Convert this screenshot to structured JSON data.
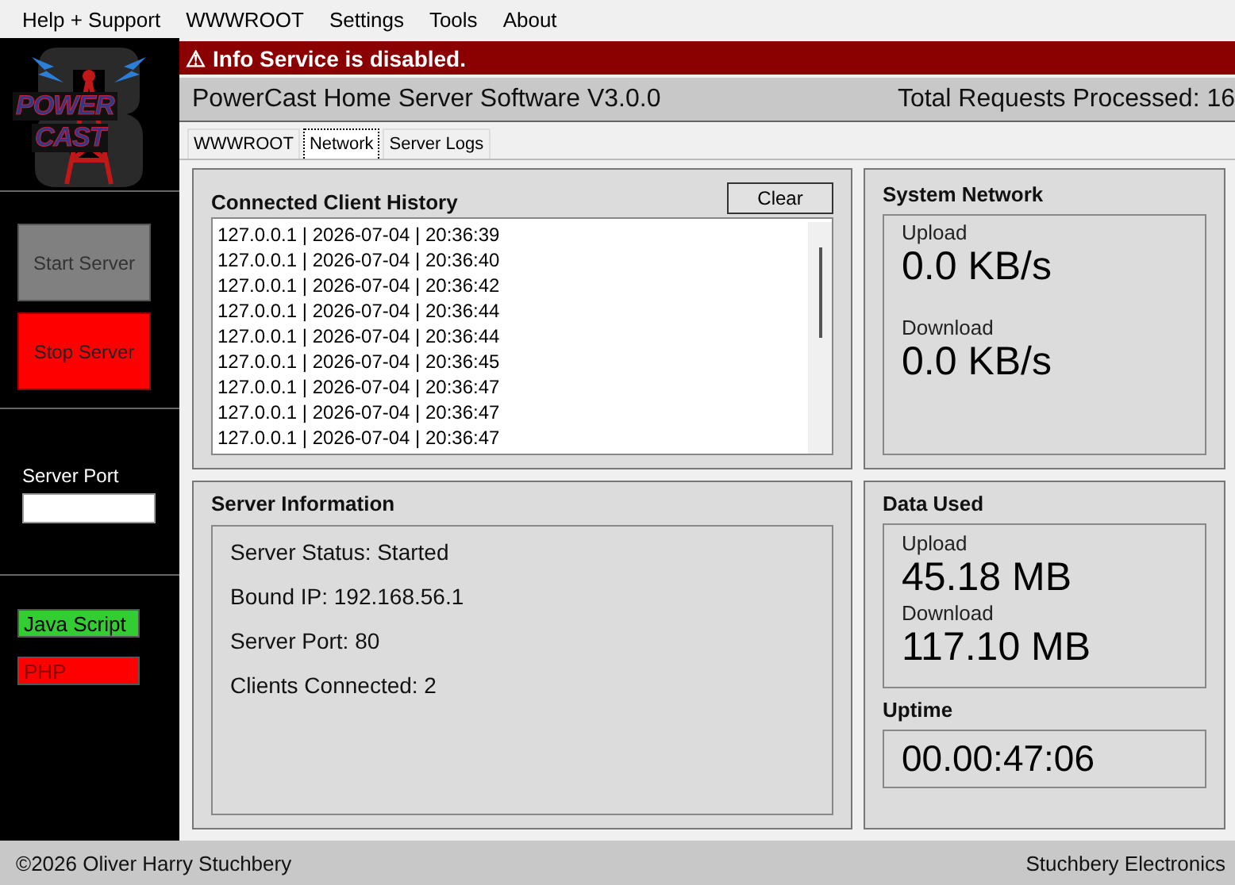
{
  "menu": [
    "Help + Support",
    "WWWROOT",
    "Settings",
    "Tools",
    "About"
  ],
  "logo": {
    "lines": [
      "POWER",
      "CAST"
    ]
  },
  "sidebar": {
    "server_buttons": [
      {
        "label": "Start Server",
        "disabled": true
      },
      {
        "label": "Stop Server",
        "disabled": false
      }
    ],
    "port": {
      "label": "Server Port"
    },
    "modules": [
      {
        "label": "Java Script",
        "enabled": true
      },
      {
        "label": "PHP",
        "enabled": false
      }
    ]
  },
  "alert": {
    "icon": "⚠",
    "text": "Info Service is disabled."
  },
  "header": {
    "title": "PowerCast Home Server Software V3.0.0",
    "requests": "Total Requests Processed: 16"
  },
  "tabs": [
    {
      "label": "WWWROOT",
      "selected": false
    },
    {
      "label": "Network",
      "selected": true
    },
    {
      "label": "Server Logs",
      "selected": false
    }
  ],
  "client_history": {
    "title": "Connected Client History",
    "clear": "Clear",
    "rows": [
      "127.0.0.1 | 2026-07-04 | 20:36:39",
      "127.0.0.1 | 2026-07-04 | 20:36:40",
      "127.0.0.1 | 2026-07-04 | 20:36:42",
      "127.0.0.1 | 2026-07-04 | 20:36:44",
      "127.0.0.1 | 2026-07-04 | 20:36:44",
      "127.0.0.1 | 2026-07-04 | 20:36:45",
      "127.0.0.1 | 2026-07-04 | 20:36:47",
      "127.0.0.1 | 2026-07-04 | 20:36:47",
      "127.0.0.1 | 2026-07-04 | 20:36:47"
    ]
  },
  "server_info": {
    "title": "Server Information",
    "lines": [
      "Server Status: Started",
      "Bound IP: 192.168.56.1",
      "Server Port: 80",
      "Clients Connected: 2"
    ]
  },
  "system_network": {
    "title": "System Network",
    "upload_label": "Upload",
    "upload": "0.0 KB/s",
    "download_label": "Download",
    "download": "0.0 KB/s"
  },
  "data_used": {
    "title": "Data Used",
    "upload_label": "Upload",
    "upload": "45.18 MB",
    "download_label": "Download",
    "download": "117.10 MB"
  },
  "uptime": {
    "title": "Uptime",
    "value": "00.00:47:06"
  },
  "footer": {
    "left": "©2026 Oliver Harry Stuchbery",
    "right": "Stuchbery Electronics"
  }
}
